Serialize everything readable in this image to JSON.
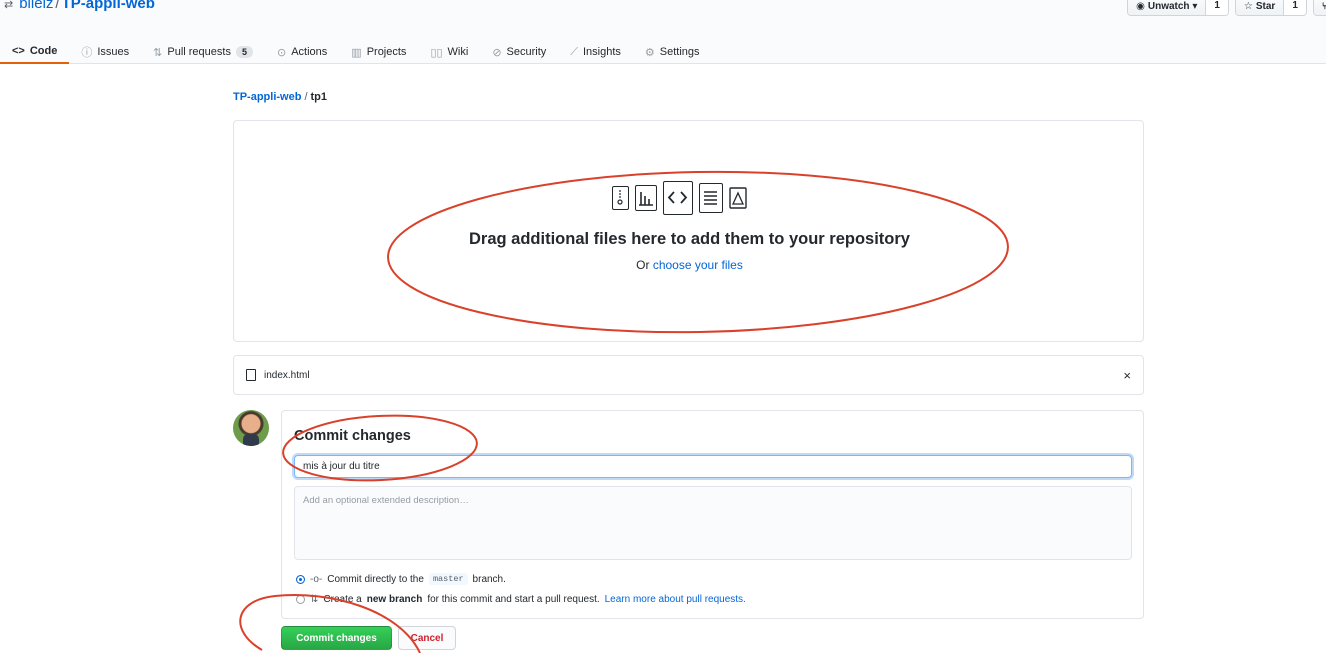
{
  "repo": {
    "owner": "bileiz",
    "name": "TP-appli-web"
  },
  "header_actions": [
    {
      "icon": "eye-icon",
      "label": "Unwatch ▾",
      "count": "1"
    },
    {
      "icon": "star-icon",
      "label": "Star",
      "count": "1"
    },
    {
      "icon": "fork-icon",
      "label": "F",
      "count": ""
    }
  ],
  "tabs": [
    {
      "icon": "code-icon",
      "glyph": "<>",
      "label": "Code",
      "selected": true
    },
    {
      "icon": "issue-icon",
      "glyph": "ⓘ",
      "label": "Issues"
    },
    {
      "icon": "pull-request-icon",
      "glyph": "⇅",
      "label": "Pull requests",
      "counter": "5"
    },
    {
      "icon": "actions-icon",
      "glyph": "⊙",
      "label": "Actions"
    },
    {
      "icon": "projects-icon",
      "glyph": "▥",
      "label": "Projects"
    },
    {
      "icon": "wiki-icon",
      "glyph": "▯▯",
      "label": "Wiki"
    },
    {
      "icon": "shield-icon",
      "glyph": "⊘",
      "label": "Security"
    },
    {
      "icon": "graph-icon",
      "glyph": "⟋",
      "label": "Insights"
    },
    {
      "icon": "gear-icon",
      "glyph": "⚙",
      "label": "Settings"
    }
  ],
  "breadcrumb": {
    "repo": "TP-appli-web",
    "sep": "/",
    "folder": "tp1"
  },
  "dropzone": {
    "title": "Drag additional files here to add them to your repository",
    "or_text": "Or",
    "choose_link": "choose your files"
  },
  "file": {
    "name": "index.html",
    "close": "×"
  },
  "commit": {
    "title": "Commit changes",
    "message": "mis à jour du titre",
    "description_placeholder": "Add an optional extended description…",
    "option_direct_prefix": "Commit directly to the",
    "branch": "master",
    "option_direct_suffix": "branch.",
    "option_new_prefix": "Create a",
    "option_new_bold": "new branch",
    "option_new_suffix": "for this commit and start a pull request.",
    "learn_more": "Learn more about pull requests."
  },
  "buttons": {
    "commit": "Commit changes",
    "cancel": "Cancel"
  },
  "colors": {
    "accent": "#0366d6",
    "tab_underline": "#e36209",
    "commit_green": "#28a745",
    "cancel_red": "#cb2431",
    "annotation_red": "#d9412b"
  }
}
